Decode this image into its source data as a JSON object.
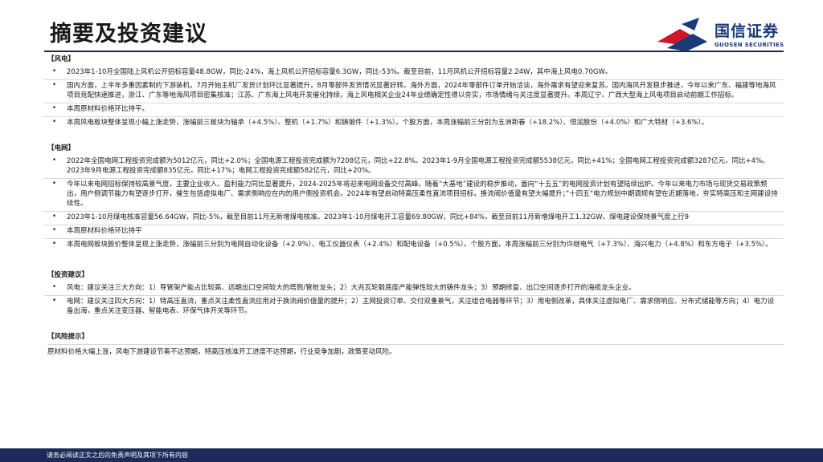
{
  "page": {
    "title": "摘要及投资建议",
    "logo_cn": "国信证券",
    "logo_en": "GUOSEN SECURITIES",
    "footer": "请务必阅读正文之后的免责声明及其项下所有内容"
  },
  "wind": {
    "heading": "【风电】",
    "items": [
      "2023年1-10月全国陆上风机公开招标容量48.8GW，同比-24%，海上风机公开招标容量6.3GW，同比-53%。截至目前，11月风机公开招标容量2.24W，其中海上风电0.70GW。",
      "国内方面，上半年多重因素制约下游装机，7月开始主机厂发货计划环比显著提升，8月零部件发货情况显著好转。海外方面，2024年零部件订单开始洽谈，海外需求有望迎来复苏。国内海风开发稳步推进，今年以来广东、福建等地海风项目竞配快速推进，浙江、广东等地海风项目密集核准；江苏、广东海上风电开发催化持续，海上风电相关企业24年业绩确定性得以夯实，市场情绪与关注度显著提升。本周辽宁、广西大型海上风电项目启动前期工作招标。",
      "本周原材料价格环比持平。",
      "本周风电板块整体呈现小幅上涨走势，涨幅前三板块为轴承（+4.5%）、整机（+1.7%）和铸锻件（+1.3%）。个股方面，本周涨幅前三分别为五洲新春（+18.2%）、恒润股份（+4.0%）和广大特材（+3.6%）。"
    ]
  },
  "grid": {
    "heading": "【电网】",
    "items": [
      "2022年全国电网工程投资完成额为5012亿元，同比+2.0%；全国电源工程投资完成额为7208亿元，同比+22.8%。2023年1-9月全国电源工程投资完成额5538亿元，同比+41%；全国电网工程投资完成额3287亿元，同比+4%。2023年9月电源工程投资完成额835亿元，同比+17%；电网工程投资完成额582亿元，同比+20%。",
      "今年以来电网招标保持较高景气度，主要企业收入、盈利能力同比显著提升，2024-2025年将迎来电网设备交付高峰。随着“大基地”建设的稳步推动，面向“十五五”的电网投资计划有望陆续出炉。今年以来电力市场与现货交易政策频出，用户侧调节能力有望逐步打开，催生包括虚拟电厂、需求侧响应在内的用户侧投资机会。2024年有望启动特高压柔性直流项目招标，换流阀价值量有望大幅提升；”十四五“电力规划中期调规有望在近期落地，夯实特高压和主网建设持续性。",
      "2023年1-10月煤电核准容量56.64GW，同比-5%，截至目前11月无新增煤电核准。2023年1-10月煤电开工容量69.80GW，同比+84%，截至目前11月新增煤电开工1.32GW。煤电建设保持景气度上行9",
      "本周原材料价格环比持平",
      "本周电网板块股价整体呈现上涨走势，涨幅前三分别为电网自动化设备（+2.9%）、电工仪器仪表（+2.4%）和配电设备（+0.5%）。个股方面，本周涨幅前三分别为许继电气（+7.3%）、海兴电力（+4.8%）和东方电子（+3.5%）。"
    ]
  },
  "invest": {
    "heading": "【投资建议】",
    "items": [
      "风电：建议关注三大方向：1）导管架产能占比较高、远期出口空间较大的塔筒/管桩龙头；2）大兆瓦轮毂底座产能弹性较大的铸件龙头；3）预期修复、出口空间逐步打开的海缆龙头企业。",
      "电网：建议关注四大方向：1）特高压直流，重点关注柔性直流应用对于换流阀价值量的提升；2）主网投资订单、交付双重景气，关注组合电器等环节；3）用电侧改革，具体关注虚拟电厂、需求侧响应、分布式储能等方向；4）电力设备出海，重点关注变压器、智能电表、环保气体开关等环节。"
    ]
  },
  "risk": {
    "heading": "【风险提示】",
    "text": "原材料价格大幅上涨，风电下游建设节奏不达预期，特高压核准开工进度不达预期，行业竞争加剧，政策变动风险。"
  },
  "bullet_char": "•",
  "colors": {
    "logo_red": "#d0152b",
    "logo_navy": "#1b3a7a",
    "footer_bg": "#1c2b5a",
    "rule": "#1f2a44"
  }
}
